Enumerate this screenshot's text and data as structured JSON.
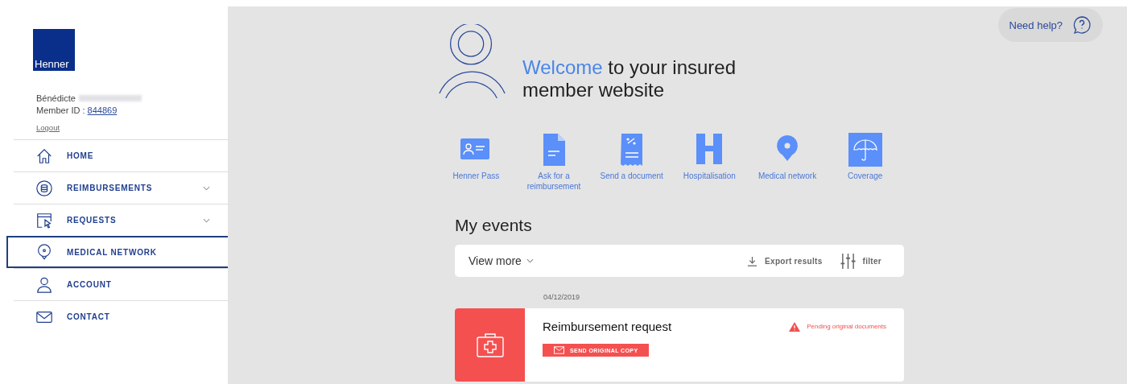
{
  "sidebar": {
    "logo": "Henner",
    "user": {
      "first_name": "Bénédicte",
      "member_id_label": "Member ID :",
      "member_id": "844869",
      "logout": "Logout"
    },
    "nav": [
      {
        "label": "HOME",
        "kind": "home",
        "expandable": false,
        "selected": false
      },
      {
        "label": "REIMBURSEMENTS",
        "kind": "coins",
        "expandable": true,
        "selected": false
      },
      {
        "label": "REQUESTS",
        "kind": "cursor",
        "expandable": true,
        "selected": false
      },
      {
        "label": "MEDICAL NETWORK",
        "kind": "pin",
        "expandable": false,
        "selected": true
      },
      {
        "label": "ACCOUNT",
        "kind": "person",
        "expandable": false,
        "selected": false
      },
      {
        "label": "CONTACT",
        "kind": "mail",
        "expandable": false,
        "selected": false
      }
    ]
  },
  "help": {
    "label": "Need help?"
  },
  "welcome": {
    "highlight": "Welcome",
    "rest": "to your insured member website"
  },
  "actions": [
    {
      "label": "Henner Pass",
      "kind": "card"
    },
    {
      "label": "Ask for a reimbursement",
      "kind": "doc"
    },
    {
      "label": "Send a document",
      "kind": "receipt"
    },
    {
      "label": "Hospitalisation",
      "kind": "h"
    },
    {
      "label": "Medical network",
      "kind": "pin"
    },
    {
      "label": "Coverage",
      "kind": "umbrella"
    }
  ],
  "events": {
    "title": "My events",
    "view_more": "View more",
    "export": "Export results",
    "filter": "filter",
    "items": [
      {
        "date": "04/12/2019",
        "title": "Reimbursement request",
        "status": "Pending original documents",
        "button": "SEND ORIGINAL COPY"
      }
    ]
  }
}
